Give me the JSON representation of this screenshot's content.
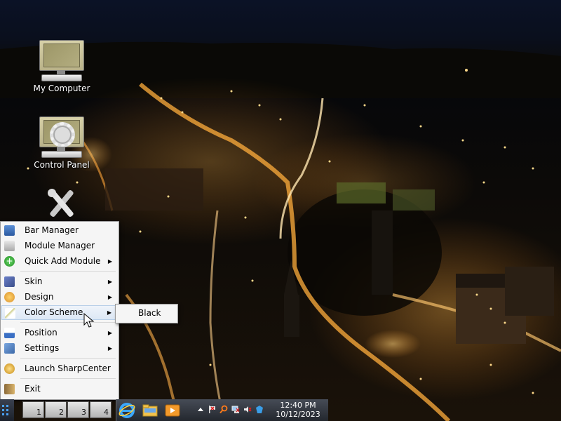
{
  "desktop": {
    "icons": [
      {
        "label": "My Computer",
        "icon": "computer-icon"
      },
      {
        "label": "Control Panel",
        "icon": "control-panel-icon"
      },
      {
        "label": "",
        "icon": "tools-icon"
      }
    ]
  },
  "menu": {
    "items": [
      {
        "label": "Bar Manager",
        "icon": "bar-manager-icon",
        "submenu": false
      },
      {
        "label": "Module Manager",
        "icon": "module-manager-icon",
        "submenu": false
      },
      {
        "label": "Quick Add Module",
        "icon": "add-icon",
        "submenu": true,
        "arrow": "▶"
      },
      {
        "label": "Skin",
        "icon": "skin-icon",
        "submenu": true,
        "arrow": "▶"
      },
      {
        "label": "Design",
        "icon": "design-icon",
        "submenu": true,
        "arrow": "▶"
      },
      {
        "label": "Color Scheme",
        "icon": "color-scheme-icon",
        "submenu": true,
        "arrow": "▶",
        "highlighted": true
      },
      {
        "label": "Position",
        "icon": "position-icon",
        "submenu": true,
        "arrow": "▶"
      },
      {
        "label": "Settings",
        "icon": "settings-icon",
        "submenu": true,
        "arrow": "▶"
      },
      {
        "label": "Launch SharpCenter",
        "icon": "sharpcenter-icon",
        "submenu": false
      },
      {
        "label": "Exit",
        "icon": "exit-icon",
        "submenu": false
      }
    ],
    "submenu": {
      "items": [
        {
          "label": "Black"
        }
      ]
    }
  },
  "taskbar": {
    "pager": [
      "1",
      "2",
      "3",
      "4"
    ],
    "quick_launch": [
      "ie-icon",
      "folder-icon",
      "media-player-icon"
    ],
    "tray": [
      "arrow-up-icon",
      "flag-icon",
      "search-icon",
      "network-icon",
      "volume-muted-icon",
      "shield-icon"
    ],
    "clock": {
      "time": "12:40 PM",
      "date": "10/12/2023"
    }
  },
  "colors": {
    "menu_bg": "#f5f5f5",
    "highlight": "#dde8f5",
    "taskbar": "#23272e",
    "accent": "#4aa3ff"
  }
}
